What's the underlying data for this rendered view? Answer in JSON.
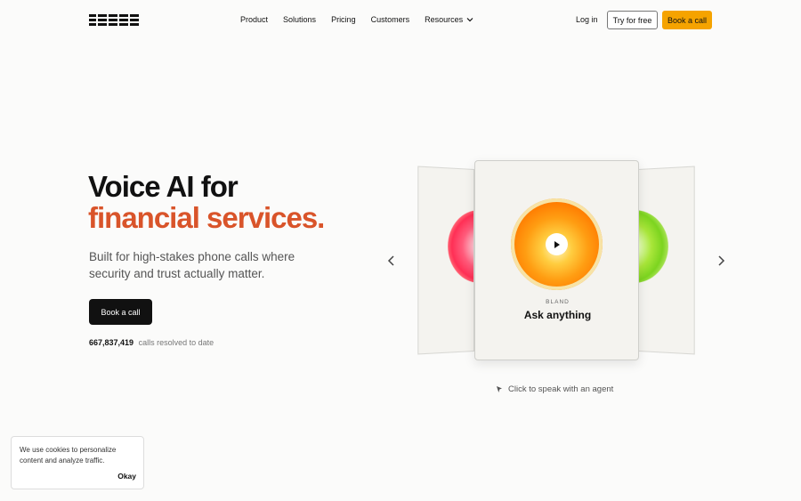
{
  "nav": {
    "logo_name": "bland-logo",
    "links": [
      "Product",
      "Solutions",
      "Pricing",
      "Customers"
    ],
    "resources_label": "Resources",
    "login_label": "Log in",
    "try_label": "Try for free",
    "book_label": "Book a call"
  },
  "hero": {
    "title_line1": "Voice AI for",
    "title_line2": "financial services.",
    "subtitle": "Built for high-stakes phone calls where security and trust actually matter.",
    "cta_label": "Book a call",
    "calls_count": "667,837,419",
    "calls_text": "calls resolved to date"
  },
  "carousel": {
    "brand_label": "BLAND",
    "card_title": "Ask anything",
    "hint": "Click to speak with an agent"
  },
  "cookie": {
    "text": "We use cookies to personalize content and analyze traffic.",
    "okay_label": "Okay"
  },
  "colors": {
    "accent": "#d9542a",
    "brand_button": "#f5a300",
    "dark_button": "#111111"
  }
}
